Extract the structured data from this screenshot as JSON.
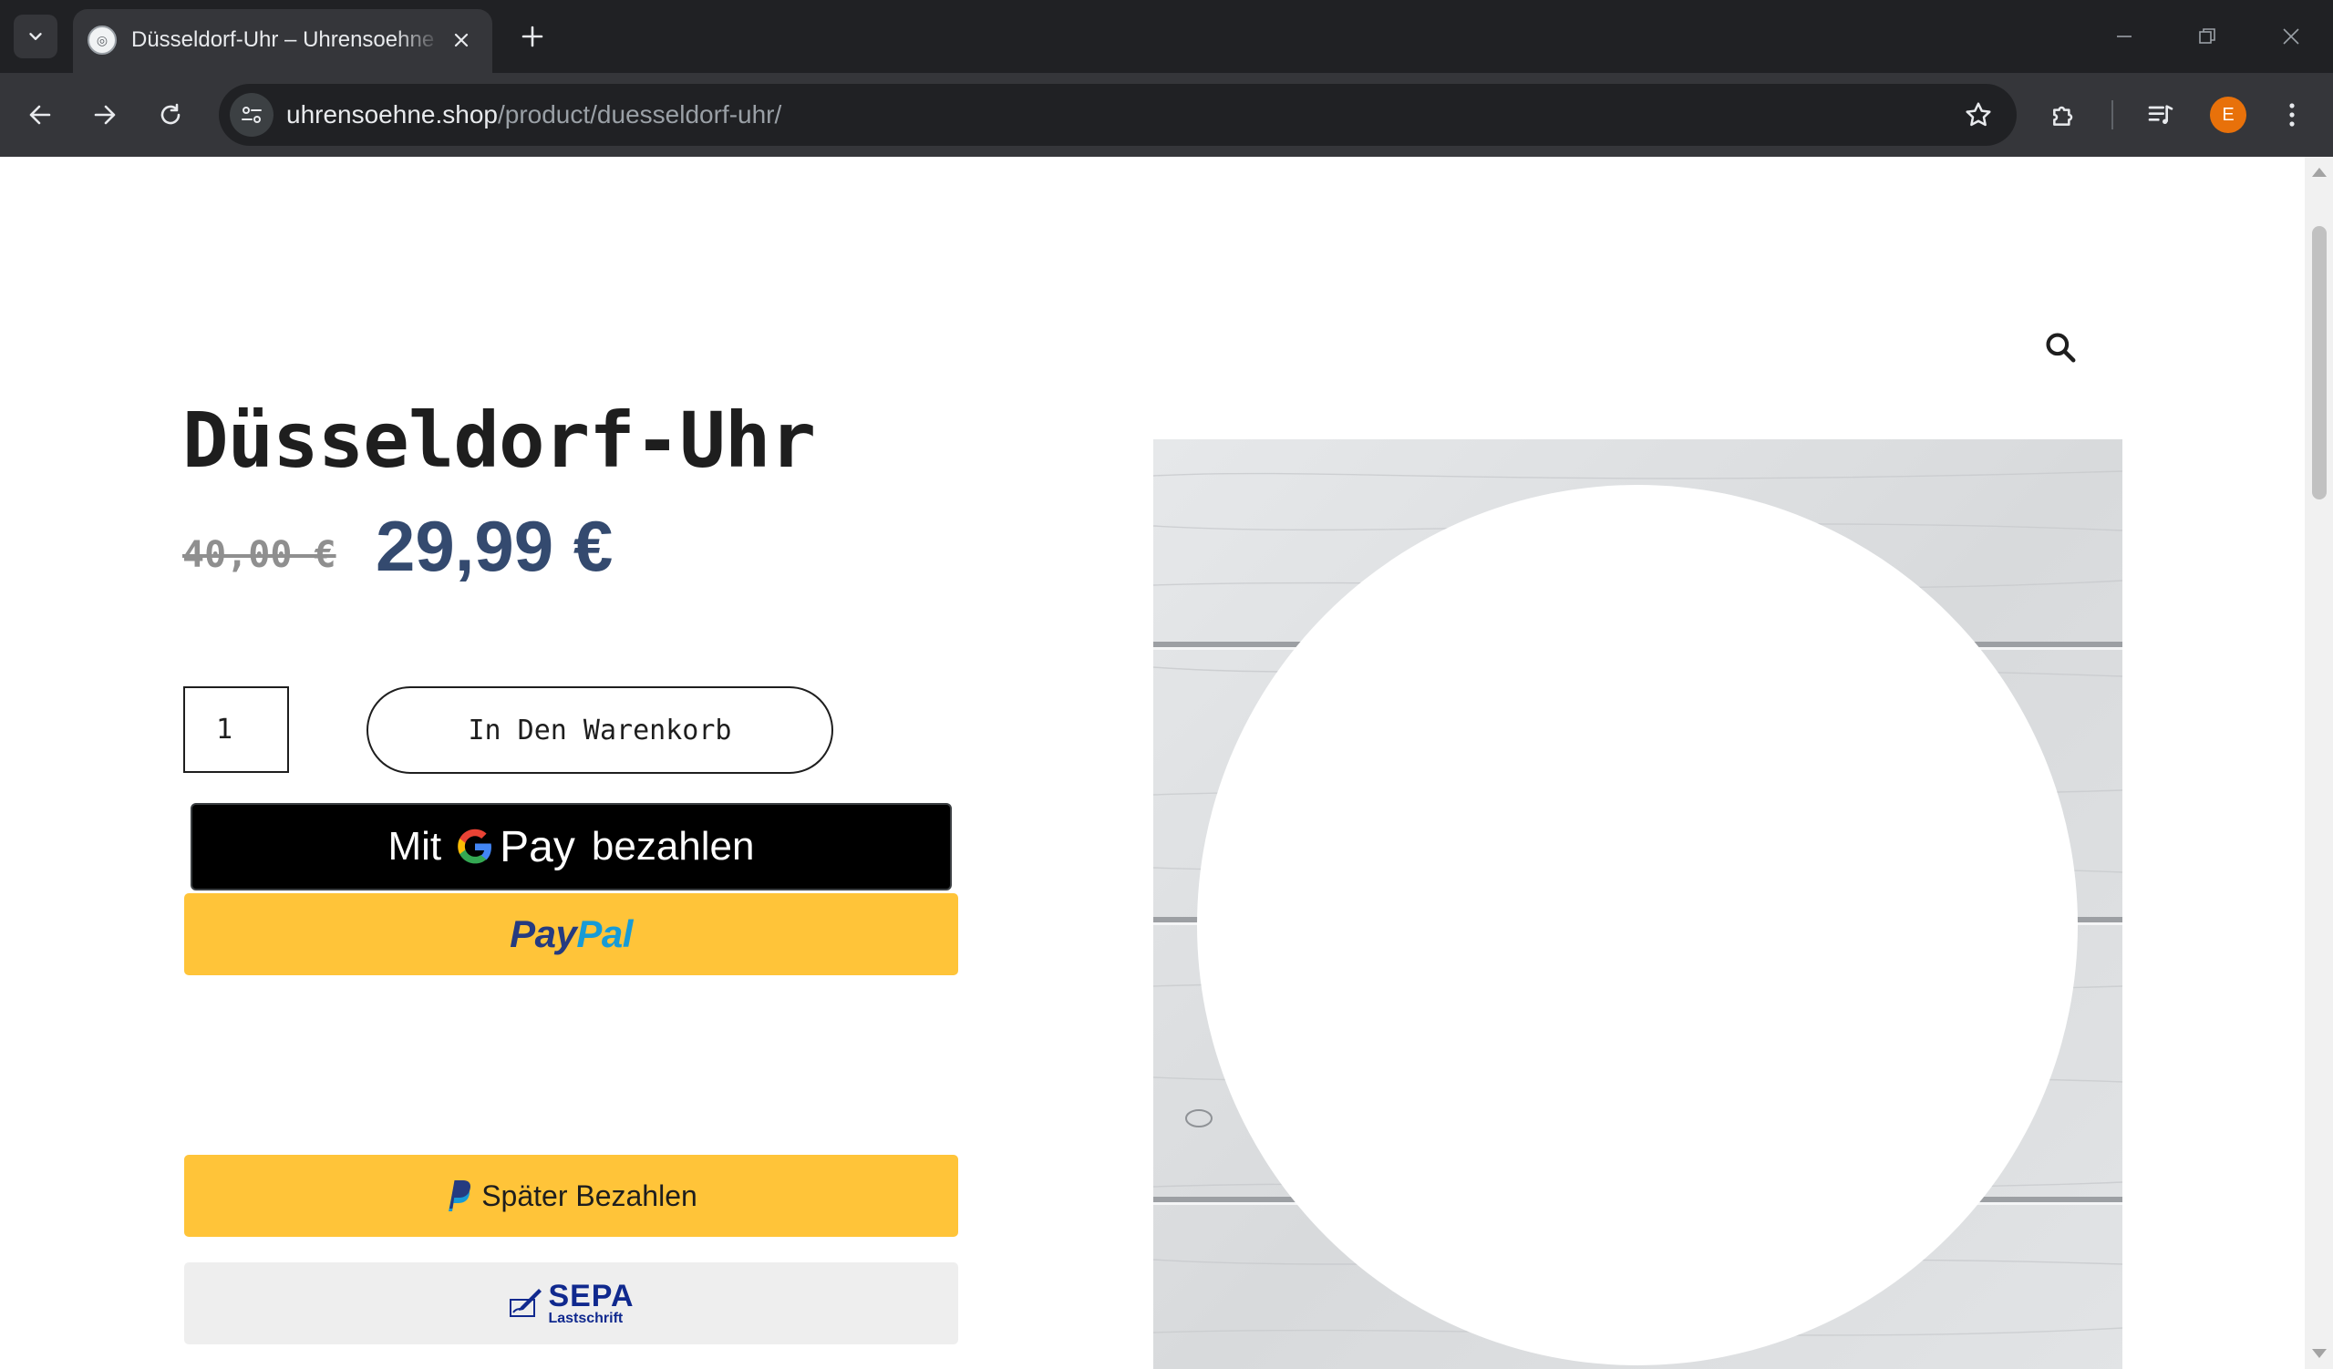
{
  "browser": {
    "tab_title": "Düsseldorf-Uhr – Uhrensoehne",
    "url_host": "uhrensoehne.shop",
    "url_path": "/product/duesseldorf-uhr/",
    "profile_initial": "E",
    "profile_color": "#e8710a",
    "icons": [
      "tab-search-icon",
      "favicon-icon",
      "close-icon",
      "plus-icon",
      "minimize-icon",
      "restore-icon",
      "window-close-icon",
      "back-icon",
      "forward-icon",
      "reload-icon",
      "site-info-icon",
      "star-icon",
      "extensions-icon",
      "media-icon",
      "kebab-menu-icon"
    ]
  },
  "product": {
    "title": "Düsseldorf-Uhr",
    "price_old": "40,00 €",
    "price_new": "29,99 €",
    "price_color": "#344a6f",
    "quantity": "1",
    "add_to_cart_label": "In Den Warenkorb"
  },
  "payments": {
    "gpay_prefix": "Mit",
    "gpay_word": "Pay",
    "gpay_suffix": "bezahlen",
    "paypal_part1": "Pay",
    "paypal_part2": "Pal",
    "paylater_label": "Später Bezahlen",
    "sepa_big": "SEPA",
    "sepa_small": "Lastschrift",
    "paypal_color": "#ffc439"
  },
  "gallery": {
    "zoom_icon": "magnifier-icon"
  }
}
